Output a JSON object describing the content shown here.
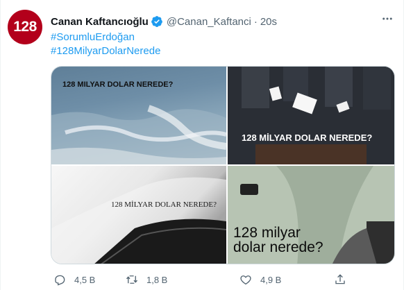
{
  "tweet": {
    "avatar_text": "128",
    "name": "Canan Kaftancıoğlu",
    "handle": "@Canan_Kaftanci",
    "separator": "·",
    "time": "20s",
    "hashtags": [
      "#SorumluErdoğan",
      "#128MilyarDolarNerede"
    ]
  },
  "media": {
    "images": [
      {
        "caption": "128 MILYAR DOLAR NEREDE?",
        "scene": "sea-waves"
      },
      {
        "caption": "128 MİLYAR DOLAR NEREDE?",
        "scene": "hands-voting-ballot-box"
      },
      {
        "caption": "128 MİLYAR DOLAR NEREDE?",
        "scene": "white-powder"
      },
      {
        "caption_line1": "128 milyar",
        "caption_line2": "dolar nerede?",
        "scene": "man-in-suit"
      }
    ]
  },
  "actions": {
    "reply_count": "4,5 B",
    "retweet_count": "1,8 B",
    "like_count": "4,9 B"
  },
  "colors": {
    "accent": "#1d9bf0",
    "avatar_bg": "#b3001b",
    "secondary_text": "#536471"
  }
}
